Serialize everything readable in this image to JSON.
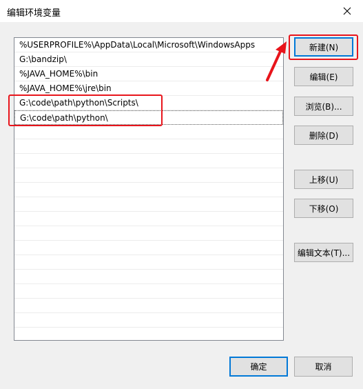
{
  "window": {
    "title": "编辑环境变量"
  },
  "list": {
    "items": [
      "%USERPROFILE%\\AppData\\Local\\Microsoft\\WindowsApps",
      "G:\\bandzip\\",
      "%JAVA_HOME%\\bin",
      "%JAVA_HOME%\\jre\\bin",
      "G:\\code\\path\\python\\Scripts\\",
      "G:\\code\\path\\python\\"
    ]
  },
  "buttons": {
    "new": "新建(N)",
    "edit": "编辑(E)",
    "browse": "浏览(B)...",
    "delete": "删除(D)",
    "move_up": "上移(U)",
    "move_down": "下移(O)",
    "edit_text": "编辑文本(T)...",
    "ok": "确定",
    "cancel": "取消"
  },
  "annotation_color": "#e8141b",
  "icons": {
    "close": "close-icon"
  }
}
